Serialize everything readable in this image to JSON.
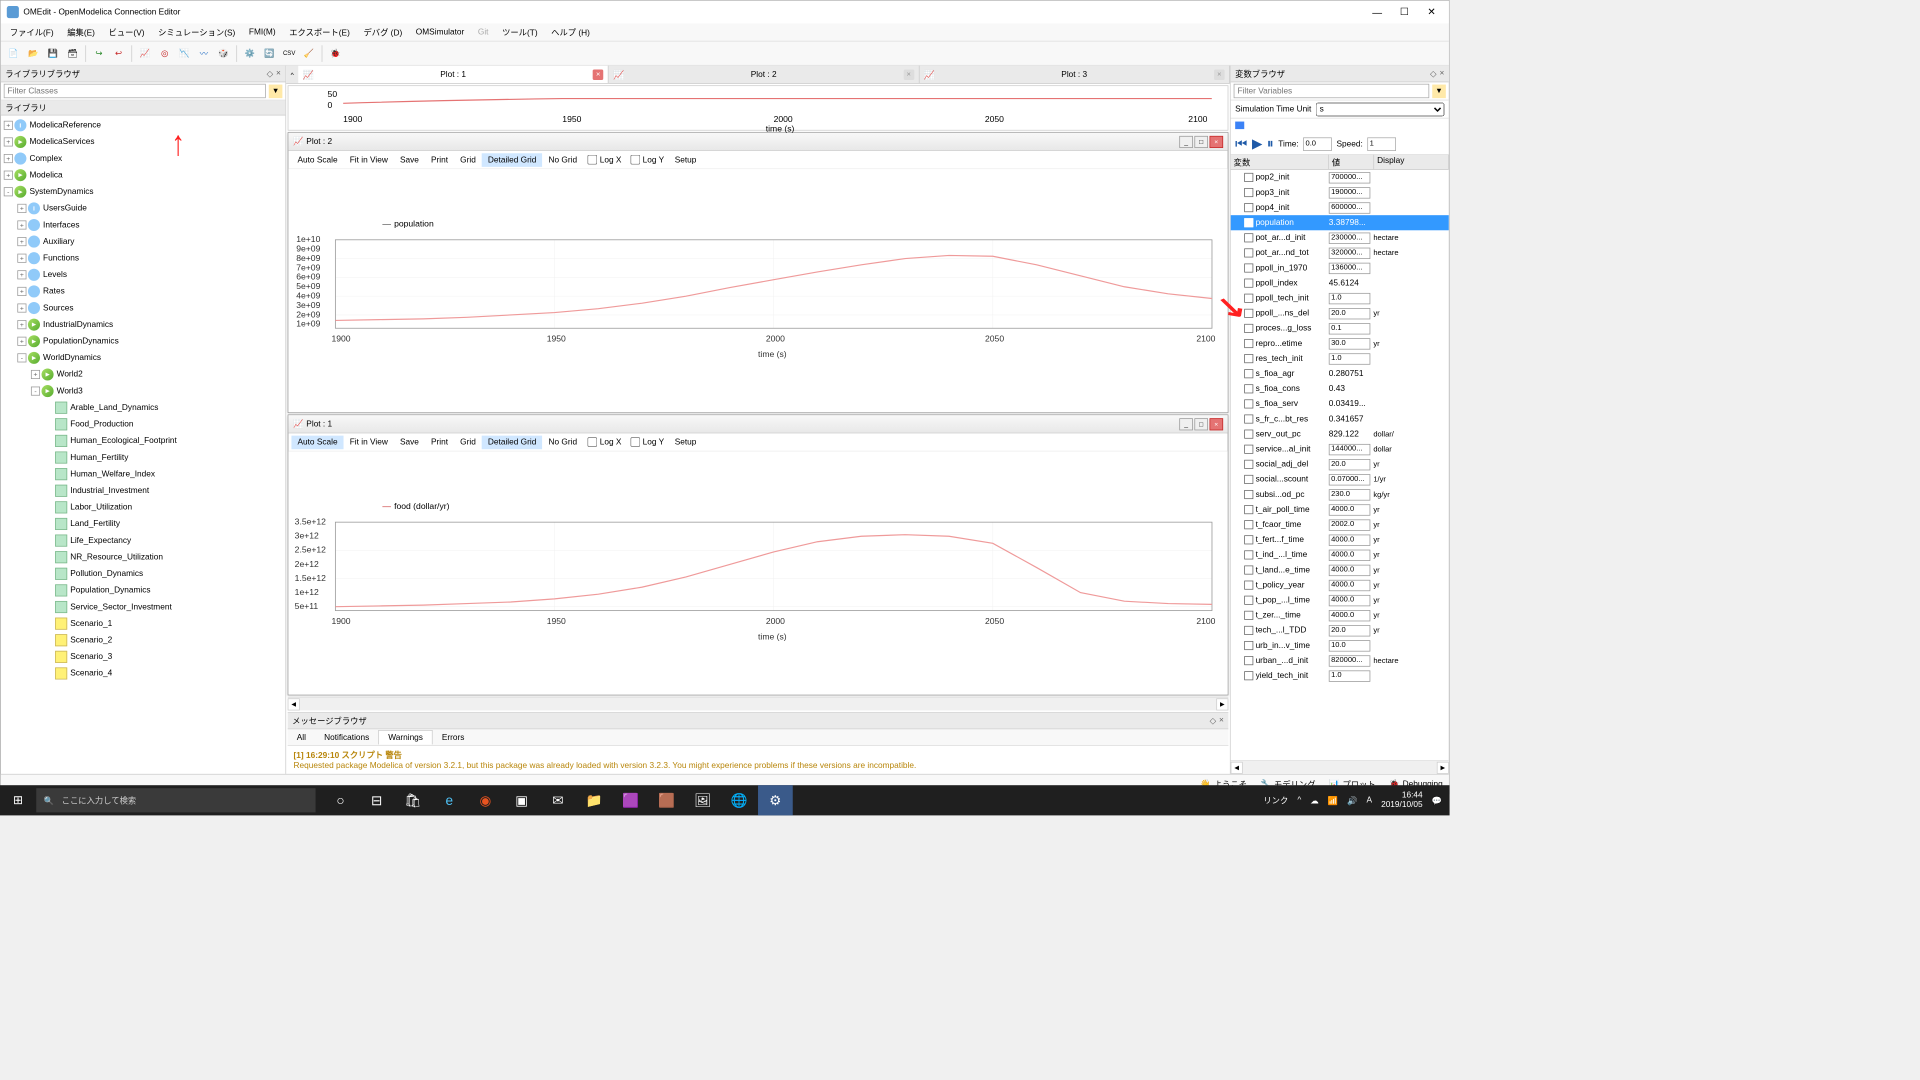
{
  "window": {
    "title": "OMEdit - OpenModelica Connection Editor"
  },
  "menu": [
    "ファイル(F)",
    "編集(E)",
    "ビュー(V)",
    "シミュレーション(S)",
    "FMI(M)",
    "エクスポート(E)",
    "デバグ  (D)",
    "OMSimulator",
    "Git",
    "ツール(T)",
    "ヘルプ (H)"
  ],
  "left": {
    "title": "ライブラリブラウザ",
    "filter_ph": "Filter Classes",
    "hdr": "ライブラリ",
    "roots": [
      {
        "exp": "+",
        "ico": "info",
        "label": "ModelicaReference"
      },
      {
        "exp": "+",
        "ico": "pkg",
        "label": "ModelicaServices"
      },
      {
        "exp": "+",
        "ico": "blue",
        "label": "Complex"
      },
      {
        "exp": "+",
        "ico": "pkg",
        "label": "Modelica"
      },
      {
        "exp": "-",
        "ico": "pkg",
        "label": "SystemDynamics"
      }
    ],
    "sd": [
      {
        "exp": "+",
        "ico": "info",
        "label": "UsersGuide",
        "ind": 1
      },
      {
        "exp": "+",
        "ico": "blue",
        "label": "Interfaces",
        "ind": 1
      },
      {
        "exp": "+",
        "ico": "blue",
        "label": "Auxiliary",
        "ind": 1
      },
      {
        "exp": "+",
        "ico": "blue",
        "label": "Functions",
        "ind": 1
      },
      {
        "exp": "+",
        "ico": "blue",
        "label": "Levels",
        "ind": 1
      },
      {
        "exp": "+",
        "ico": "blue",
        "label": "Rates",
        "ind": 1
      },
      {
        "exp": "+",
        "ico": "blue",
        "label": "Sources",
        "ind": 1
      },
      {
        "exp": "+",
        "ico": "pkg",
        "label": "IndustrialDynamics",
        "ind": 1
      },
      {
        "exp": "+",
        "ico": "pkg",
        "label": "PopulationDynamics",
        "ind": 1
      },
      {
        "exp": "-",
        "ico": "pkg",
        "label": "WorldDynamics",
        "ind": 1
      },
      {
        "exp": "+",
        "ico": "pkg",
        "label": "World2",
        "ind": 2
      },
      {
        "exp": "-",
        "ico": "pkg",
        "label": "World3",
        "ind": 2
      },
      {
        "exp": "",
        "ico": "mdl",
        "label": "Arable_Land_Dynamics",
        "ind": 3
      },
      {
        "exp": "",
        "ico": "mdl",
        "label": "Food_Production",
        "ind": 3
      },
      {
        "exp": "",
        "ico": "mdl",
        "label": "Human_Ecological_Footprint",
        "ind": 3
      },
      {
        "exp": "",
        "ico": "mdl",
        "label": "Human_Fertility",
        "ind": 3
      },
      {
        "exp": "",
        "ico": "mdl",
        "label": "Human_Welfare_Index",
        "ind": 3
      },
      {
        "exp": "",
        "ico": "mdl",
        "label": "Industrial_Investment",
        "ind": 3
      },
      {
        "exp": "",
        "ico": "mdl",
        "label": "Labor_Utilization",
        "ind": 3
      },
      {
        "exp": "",
        "ico": "mdl",
        "label": "Land_Fertility",
        "ind": 3
      },
      {
        "exp": "",
        "ico": "mdl",
        "label": "Life_Expectancy",
        "ind": 3
      },
      {
        "exp": "",
        "ico": "mdl",
        "label": "NR_Resource_Utilization",
        "ind": 3
      },
      {
        "exp": "",
        "ico": "mdl",
        "label": "Pollution_Dynamics",
        "ind": 3
      },
      {
        "exp": "",
        "ico": "mdl",
        "label": "Population_Dynamics",
        "ind": 3
      },
      {
        "exp": "",
        "ico": "mdl",
        "label": "Service_Sector_Investment",
        "ind": 3
      },
      {
        "exp": "",
        "ico": "scn",
        "label": "Scenario_1",
        "ind": 3
      },
      {
        "exp": "",
        "ico": "scn",
        "label": "Scenario_2",
        "ind": 3
      },
      {
        "exp": "",
        "ico": "scn",
        "label": "Scenario_3",
        "ind": 3
      },
      {
        "exp": "",
        "ico": "scn",
        "label": "Scenario_4",
        "ind": 3
      }
    ]
  },
  "tabs": [
    {
      "label": "Plot : 1",
      "active": true
    },
    {
      "label": "Plot : 2",
      "active": false
    },
    {
      "label": "Plot : 3",
      "active": false
    }
  ],
  "plot_toolbar": [
    "Auto Scale",
    "Fit in View",
    "Save",
    "Print",
    "Grid",
    "Detailed Grid",
    "No Grid"
  ],
  "plot_checks": [
    "Log X",
    "Log Y"
  ],
  "plot_setup": "Setup",
  "plot2": {
    "title": "Plot : 2",
    "legend": "population",
    "xlabel": "time (s)"
  },
  "plot1": {
    "title": "Plot : 1",
    "legend": "food (dollar/yr)",
    "xlabel": "time (s)"
  },
  "chart_data": [
    {
      "type": "line",
      "title": "Plot : 2",
      "series_name": "population",
      "xlabel": "time (s)",
      "xlim": [
        1900,
        2100
      ],
      "xticks": [
        1900,
        1950,
        2000,
        2050,
        2100
      ],
      "yticks_labels": [
        "1e+09",
        "2e+09",
        "3e+09",
        "4e+09",
        "5e+09",
        "6e+09",
        "7e+09",
        "8e+09",
        "9e+09",
        "1e+10"
      ],
      "x": [
        1900,
        1910,
        1920,
        1930,
        1940,
        1950,
        1960,
        1970,
        1980,
        1990,
        2000,
        2010,
        2020,
        2030,
        2040,
        2050,
        2060,
        2070,
        2080,
        2090,
        2100
      ],
      "y": [
        1700000000.0,
        1800000000.0,
        1900000000.0,
        2100000000.0,
        2300000000.0,
        2600000000.0,
        3000000000.0,
        3600000000.0,
        4400000000.0,
        5300000000.0,
        6200000000.0,
        7100000000.0,
        7900000000.0,
        8600000000.0,
        8900000000.0,
        8800000000.0,
        7900000000.0,
        6600000000.0,
        5400000000.0,
        4600000000.0,
        4100000000.0
      ]
    },
    {
      "type": "line",
      "title": "Plot : 1",
      "series_name": "food (dollar/yr)",
      "xlabel": "time (s)",
      "xlim": [
        1900,
        2100
      ],
      "xticks": [
        1900,
        1950,
        2000,
        2050,
        2100
      ],
      "yticks_labels": [
        "5e+11",
        "1e+12",
        "1.5e+12",
        "2e+12",
        "2.5e+12",
        "3e+12",
        "3.5e+12"
      ],
      "x": [
        1900,
        1910,
        1920,
        1930,
        1940,
        1950,
        1960,
        1970,
        1980,
        1990,
        2000,
        2010,
        2020,
        2030,
        2040,
        2050,
        2060,
        2070,
        2080,
        2090,
        2100
      ],
      "y": [
        600000000000.0,
        630000000000.0,
        670000000000.0,
        720000000000.0,
        780000000000.0,
        880000000000.0,
        1050000000000.0,
        1300000000000.0,
        1650000000000.0,
        2100000000000.0,
        2550000000000.0,
        2900000000000.0,
        3100000000000.0,
        3150000000000.0,
        3100000000000.0,
        2850000000000.0,
        2000000000000.0,
        1100000000000.0,
        800000000000.0,
        720000000000.0,
        700000000000.0
      ]
    }
  ],
  "msg": {
    "title": "メッセージブラウザ",
    "tabs": [
      "All",
      "Notifications",
      "Warnings",
      "Errors"
    ],
    "active_tab": 2,
    "line1": "[1] 16:29:10 スクリプト   警告",
    "line2": "Requested package Modelica of version 3.2.1, but this package was already loaded with version 3.2.3. You might experience problems if these versions are incompatible."
  },
  "right": {
    "title": "変数ブラウザ",
    "filter_ph": "Filter Variables",
    "unit_label": "Simulation Time Unit",
    "unit_value": "s",
    "time_label": "Time:",
    "time_value": "0.0",
    "speed_label": "Speed:",
    "speed_value": "1",
    "hdr": [
      "変数",
      "値",
      "Display"
    ],
    "vars": [
      {
        "n": "pop2_init",
        "v": "700000...",
        "box": true,
        "u": ""
      },
      {
        "n": "pop3_init",
        "v": "190000...",
        "box": true,
        "u": ""
      },
      {
        "n": "pop4_init",
        "v": "600000...",
        "box": true,
        "u": ""
      },
      {
        "n": "population",
        "v": "3.38798...",
        "sel": true,
        "u": ""
      },
      {
        "n": "pot_ar...d_init",
        "v": "230000...",
        "box": true,
        "u": "hectare"
      },
      {
        "n": "pot_ar...nd_tot",
        "v": "320000...",
        "box": true,
        "u": "hectare"
      },
      {
        "n": "ppoll_in_1970",
        "v": "136000...",
        "box": true,
        "u": ""
      },
      {
        "n": "ppoll_index",
        "v": "45.6124",
        "u": ""
      },
      {
        "n": "ppoll_tech_init",
        "v": "1.0",
        "box": true,
        "u": ""
      },
      {
        "n": "ppoll_...ns_del",
        "v": "20.0",
        "box": true,
        "u": "yr"
      },
      {
        "n": "proces...g_loss",
        "v": "0.1",
        "box": true,
        "u": ""
      },
      {
        "n": "repro...etime",
        "v": "30.0",
        "box": true,
        "u": "yr"
      },
      {
        "n": "res_tech_init",
        "v": "1.0",
        "box": true,
        "u": ""
      },
      {
        "n": "s_fioa_agr",
        "v": "0.280751",
        "u": ""
      },
      {
        "n": "s_fioa_cons",
        "v": "0.43",
        "u": ""
      },
      {
        "n": "s_fioa_serv",
        "v": "0.03419...",
        "u": ""
      },
      {
        "n": "s_fr_c...bt_res",
        "v": "0.341657",
        "u": ""
      },
      {
        "n": "serv_out_pc",
        "v": "829.122",
        "u": "dollar/"
      },
      {
        "n": "service...al_init",
        "v": "144000...",
        "box": true,
        "u": "dollar"
      },
      {
        "n": "social_adj_del",
        "v": "20.0",
        "box": true,
        "u": "yr"
      },
      {
        "n": "social...scount",
        "v": "0.07000...",
        "box": true,
        "u": "1/yr"
      },
      {
        "n": "subsi...od_pc",
        "v": "230.0",
        "box": true,
        "u": "kg/yr"
      },
      {
        "n": "t_air_poll_time",
        "v": "4000.0",
        "box": true,
        "u": "yr"
      },
      {
        "n": "t_fcaor_time",
        "v": "2002.0",
        "box": true,
        "u": "yr"
      },
      {
        "n": "t_fert...f_time",
        "v": "4000.0",
        "box": true,
        "u": "yr"
      },
      {
        "n": "t_ind_...l_time",
        "v": "4000.0",
        "box": true,
        "u": "yr"
      },
      {
        "n": "t_land...e_time",
        "v": "4000.0",
        "box": true,
        "u": "yr"
      },
      {
        "n": "t_policy_year",
        "v": "4000.0",
        "box": true,
        "u": "yr"
      },
      {
        "n": "t_pop_...l_time",
        "v": "4000.0",
        "box": true,
        "u": "yr"
      },
      {
        "n": "t_zer..._time",
        "v": "4000.0",
        "box": true,
        "u": "yr"
      },
      {
        "n": "tech_...l_TDD",
        "v": "20.0",
        "box": true,
        "u": "yr"
      },
      {
        "n": "urb_in...v_time",
        "v": "10.0",
        "box": true,
        "u": ""
      },
      {
        "n": "urban_...d_init",
        "v": "820000...",
        "box": true,
        "u": "hectare"
      },
      {
        "n": "yield_tech_init",
        "v": "1.0",
        "box": true,
        "u": ""
      }
    ]
  },
  "bottom": [
    {
      "ico": "👋",
      "label": "ようこそ"
    },
    {
      "ico": "🔧",
      "label": "モデリング"
    },
    {
      "ico": "📊",
      "label": "プロット"
    },
    {
      "ico": "🐞",
      "label": "Debugging"
    }
  ],
  "taskbar": {
    "search_ph": "ここに入力して検索",
    "tray_lang": "リンク",
    "clock_time": "16:44",
    "clock_date": "2019/10/05"
  }
}
